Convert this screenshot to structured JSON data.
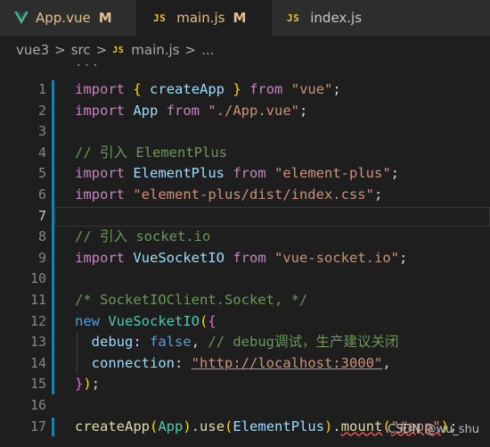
{
  "tabs": [
    {
      "name": "App.vue",
      "status": "M",
      "icon": "vue-icon"
    },
    {
      "name": "main.js",
      "status": "M",
      "icon": "js-icon",
      "icon_text": "JS",
      "unsaved": true
    },
    {
      "name": "index.js",
      "icon": "js-icon",
      "icon_text": "JS"
    }
  ],
  "breadcrumb": {
    "parts": [
      "vue3",
      "src",
      "main.js",
      "..."
    ],
    "file_icon_text": "JS",
    "separator": ">"
  },
  "editor": {
    "fold_dots": "···",
    "current_line": 7,
    "lines": [
      {
        "num": "1",
        "tokens": [
          [
            "kw",
            "import"
          ],
          [
            "pl",
            " "
          ],
          [
            "br1",
            "{"
          ],
          [
            "pl",
            " "
          ],
          [
            "id",
            "createApp"
          ],
          [
            "pl",
            " "
          ],
          [
            "br1",
            "}"
          ],
          [
            "pl",
            " "
          ],
          [
            "kw",
            "from"
          ],
          [
            "pl",
            " "
          ],
          [
            "str",
            "\"vue\""
          ],
          [
            "pl",
            ";"
          ]
        ]
      },
      {
        "num": "2",
        "tokens": [
          [
            "kw",
            "import"
          ],
          [
            "pl",
            " "
          ],
          [
            "id",
            "App"
          ],
          [
            "pl",
            " "
          ],
          [
            "kw",
            "from"
          ],
          [
            "pl",
            " "
          ],
          [
            "str",
            "\"./App.vue\""
          ],
          [
            "pl",
            ";"
          ]
        ]
      },
      {
        "num": "3",
        "tokens": []
      },
      {
        "num": "4",
        "tokens": [
          [
            "cm",
            "// 引入 ElementPlus"
          ]
        ]
      },
      {
        "num": "5",
        "tokens": [
          [
            "kw",
            "import"
          ],
          [
            "pl",
            " "
          ],
          [
            "id",
            "ElementPlus"
          ],
          [
            "pl",
            " "
          ],
          [
            "kw",
            "from"
          ],
          [
            "pl",
            " "
          ],
          [
            "str",
            "\"element-plus\""
          ],
          [
            "pl",
            ";"
          ]
        ]
      },
      {
        "num": "6",
        "tokens": [
          [
            "kw",
            "import"
          ],
          [
            "pl",
            " "
          ],
          [
            "str",
            "\"element-plus/dist/index.css\""
          ],
          [
            "pl",
            ";"
          ]
        ]
      },
      {
        "num": "7",
        "tokens": []
      },
      {
        "num": "8",
        "tokens": [
          [
            "cm",
            "// 引入 socket.io"
          ]
        ]
      },
      {
        "num": "9",
        "tokens": [
          [
            "kw",
            "import"
          ],
          [
            "pl",
            " "
          ],
          [
            "id",
            "VueSocketIO"
          ],
          [
            "pl",
            " "
          ],
          [
            "kw",
            "from"
          ],
          [
            "pl",
            " "
          ],
          [
            "str",
            "\"vue-socket.io\""
          ],
          [
            "pl",
            ";"
          ]
        ]
      },
      {
        "num": "10",
        "tokens": []
      },
      {
        "num": "11",
        "tokens": [
          [
            "cm",
            "/* SocketIOClient.Socket, */"
          ]
        ]
      },
      {
        "num": "12",
        "tokens": [
          [
            "kw2",
            "new"
          ],
          [
            "pl",
            " "
          ],
          [
            "cls",
            "VueSocketIO"
          ],
          [
            "br1",
            "("
          ],
          [
            "br2",
            "{"
          ]
        ]
      },
      {
        "num": "13",
        "tokens": [
          [
            "pl",
            "  "
          ],
          [
            "id",
            "debug"
          ],
          [
            "pl",
            ": "
          ],
          [
            "kw2",
            "false"
          ],
          [
            "pl",
            ", "
          ],
          [
            "cm",
            "// debug调试，生产建议关闭"
          ]
        ]
      },
      {
        "num": "14",
        "tokens": [
          [
            "pl",
            "  "
          ],
          [
            "id",
            "connection"
          ],
          [
            "pl",
            ": "
          ],
          [
            "str",
            "\"http://localhost:3000\""
          ],
          [
            "pl",
            ","
          ]
        ]
      },
      {
        "num": "15",
        "tokens": [
          [
            "br2",
            "}"
          ],
          [
            "br1",
            ")"
          ],
          [
            "pl",
            ";"
          ]
        ]
      },
      {
        "num": "16",
        "tokens": []
      },
      {
        "num": "17",
        "tokens": [
          [
            "fn",
            "createApp"
          ],
          [
            "br1",
            "("
          ],
          [
            "cls",
            "App"
          ],
          [
            "br1",
            ")"
          ],
          [
            "pl",
            "."
          ],
          [
            "fn",
            "use"
          ],
          [
            "br1",
            "("
          ],
          [
            "id",
            "ElementPlus"
          ],
          [
            "br1",
            ")"
          ],
          [
            "pl",
            "."
          ],
          [
            "fn",
            "mount"
          ],
          [
            "br1",
            "("
          ],
          [
            "str",
            "\"#app\""
          ],
          [
            "br1",
            ")"
          ],
          [
            "pl",
            ";"
          ]
        ]
      }
    ]
  },
  "watermark": "CSDN @wu_shu",
  "colors": {
    "keyword": "#c586c0",
    "string": "#ce9178",
    "comment": "#6a9955",
    "identifier": "#9cdcfe",
    "modified": "#e2c08d",
    "gutter_marker": "#1b81a8"
  }
}
